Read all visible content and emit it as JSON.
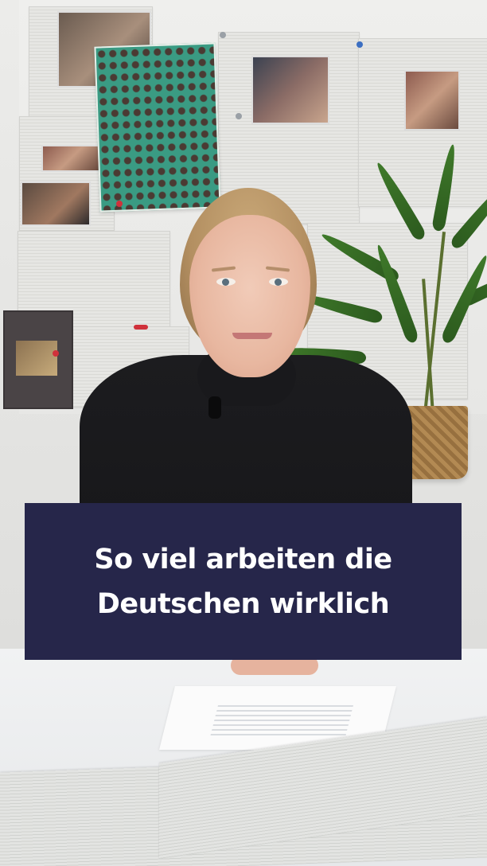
{
  "caption": {
    "line1": "So viel arbeiten die",
    "line2": "Deutschen wirklich"
  },
  "colors": {
    "caption_background": "#26264a",
    "caption_text": "#ffffff"
  }
}
